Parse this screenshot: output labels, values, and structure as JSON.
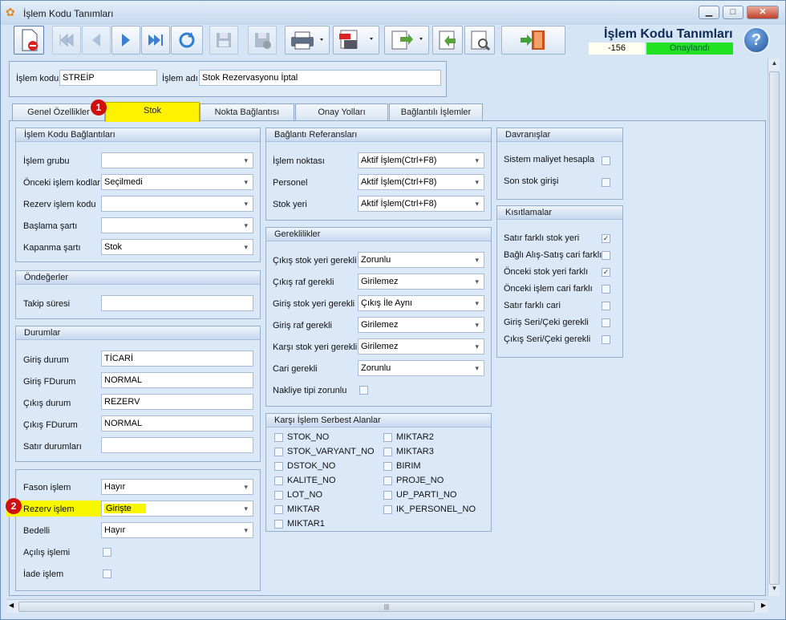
{
  "window": {
    "title": "İşlem Kodu Tanımları"
  },
  "header": {
    "title": "İşlem Kodu Tanımları",
    "code": "-156",
    "status": "Onaylandı",
    "status_color": "#22e022"
  },
  "toolbar": {
    "icons": [
      "new-doc-icon",
      "first-icon",
      "prev-icon",
      "next-icon",
      "last-icon",
      "refresh-icon",
      "save-icon",
      "save-cancel-icon",
      "print-icon",
      "pdf-icon",
      "export-icon",
      "import-icon",
      "tools-icon",
      "exit-icon",
      "help-icon"
    ]
  },
  "id": {
    "code_label": "İşlem kodu",
    "code_value": "STREİP",
    "name_label": "İşlem adı",
    "name_value": "Stok Rezervasyonu İptal"
  },
  "tabs": [
    "Genel Özellikler",
    "Stok",
    "Nokta Bağlantısı",
    "Onay Yolları",
    "Bağlantılı İşlemler"
  ],
  "badges": [
    "1",
    "2"
  ],
  "links": {
    "title": "İşlem Kodu Bağlantıları",
    "rows": [
      {
        "label": "İşlem grubu",
        "value": ""
      },
      {
        "label": "Önceki işlem kodları",
        "value": "Seçilmedi"
      },
      {
        "label": "Rezerv işlem kodu",
        "value": ""
      },
      {
        "label": "Başlama şartı",
        "value": ""
      },
      {
        "label": "Kapanma şartı",
        "value": "Stok"
      }
    ]
  },
  "defaults": {
    "title": "Öndeğerler",
    "rows": [
      {
        "label": "Takip süresi",
        "value": ""
      }
    ]
  },
  "states": {
    "title": "Durumlar",
    "rows": [
      {
        "label": "Giriş durum",
        "value": "TİCARİ"
      },
      {
        "label": "Giriş FDurum",
        "value": "NORMAL"
      },
      {
        "label": "Çıkış durum",
        "value": "REZERV"
      },
      {
        "label": "Çıkış FDurum",
        "value": "NORMAL"
      },
      {
        "label": "Satır durumları",
        "value": ""
      }
    ]
  },
  "misc": {
    "rows": [
      {
        "label": "Fason işlem",
        "value": "Hayır"
      },
      {
        "label": "Rezerv işlem",
        "value": "Girişte"
      },
      {
        "label": "Bedelli",
        "value": "Hayır"
      }
    ],
    "checks": [
      {
        "label": "Açılış işlemi",
        "checked": false
      },
      {
        "label": "İade işlem",
        "checked": false
      }
    ]
  },
  "refs": {
    "title": "Bağlantı Referansları",
    "rows": [
      {
        "label": "İşlem noktası",
        "value": "Aktif İşlem(Ctrl+F8)"
      },
      {
        "label": "Personel",
        "value": "Aktif İşlem(Ctrl+F8)"
      },
      {
        "label": "Stok yeri",
        "value": "Aktif İşlem(Ctrl+F8)"
      }
    ]
  },
  "requirements": {
    "title": "Gereklilikler",
    "rows": [
      {
        "label": "Çıkış stok yeri gerekli",
        "value": "Zorunlu"
      },
      {
        "label": "Çıkış raf gerekli",
        "value": "Girilemez"
      },
      {
        "label": "Giriş stok yeri gerekli",
        "value": "Çıkış İle Aynı"
      },
      {
        "label": "Giriş raf gerekli",
        "value": "Girilemez"
      },
      {
        "label": "Karşı stok yeri gerekli",
        "value": "Girilemez"
      },
      {
        "label": "Cari gerekli",
        "value": "Zorunlu"
      }
    ],
    "check": {
      "label": "Nakliye tipi zorunlu",
      "checked": false
    }
  },
  "free_fields": {
    "title": "Karşı İşlem Serbest Alanlar",
    "left": [
      "STOK_NO",
      "STOK_VARYANT_NO",
      "DSTOK_NO",
      "KALITE_NO",
      "LOT_NO",
      "MIKTAR",
      "MIKTAR1"
    ],
    "right": [
      "MIKTAR2",
      "MIKTAR3",
      "BIRIM",
      "PROJE_NO",
      "UP_PARTI_NO",
      "IK_PERSONEL_NO"
    ]
  },
  "behaviors": {
    "title": "Davranışlar",
    "checks": [
      {
        "label": "Sistem maliyet hesapla",
        "checked": false
      },
      {
        "label": "Son stok girişi",
        "checked": false
      }
    ]
  },
  "constraints": {
    "title": "Kısıtlamalar",
    "checks": [
      {
        "label": "Satır farklı stok yeri",
        "checked": true
      },
      {
        "label": "Bağlı Alış-Satış cari farklı",
        "checked": false
      },
      {
        "label": "Önceki stok yeri farklı",
        "checked": true
      },
      {
        "label": "Önceki işlem cari farklı",
        "checked": false
      },
      {
        "label": "Satır farklı cari",
        "checked": false
      },
      {
        "label": "Giriş Seri/Çeki gerekli",
        "checked": false
      },
      {
        "label": "Çıkış Seri/Çeki gerekli",
        "checked": false
      }
    ]
  },
  "marks": {
    "check": "✓"
  }
}
